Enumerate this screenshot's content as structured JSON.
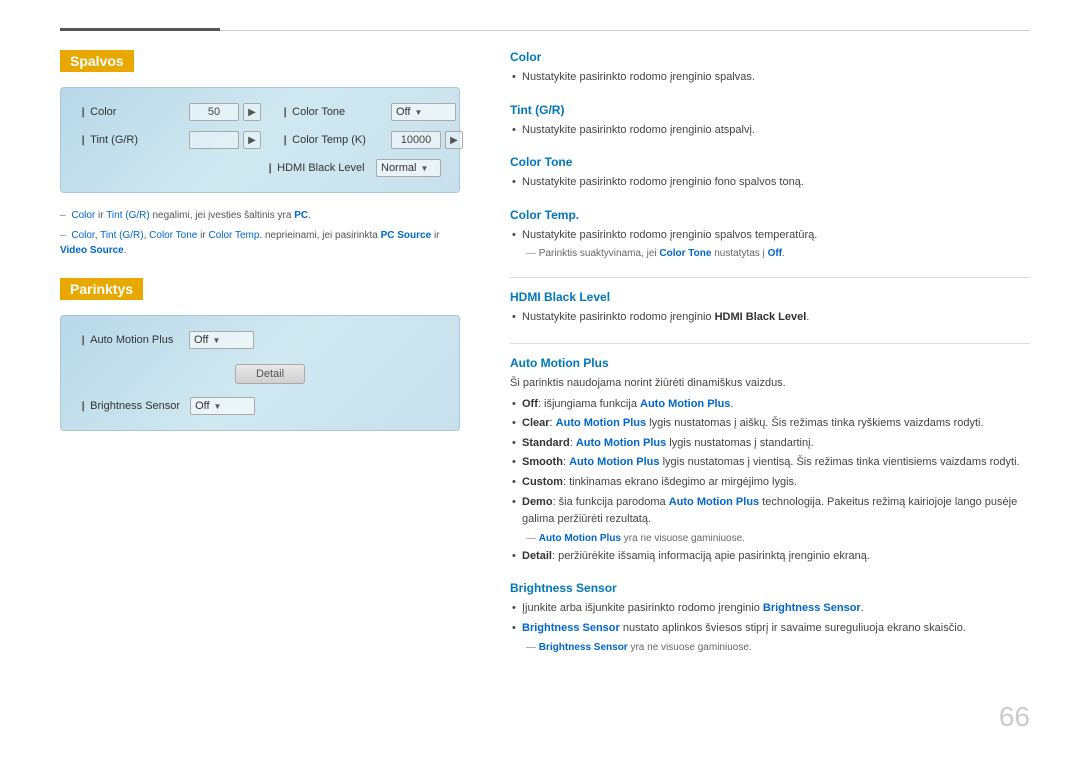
{
  "page": {
    "number": "66",
    "top_line": true
  },
  "spalvos": {
    "title": "Spalvos",
    "settings": {
      "color_label": "Color",
      "color_value": "50",
      "tint_label": "Tint (G/R)",
      "color_tone_label": "Color Tone",
      "color_tone_value": "Off",
      "color_temp_label": "Color Temp (K)",
      "color_temp_value": "10000",
      "hdmi_label": "HDMI Black Level",
      "hdmi_value": "Normal"
    },
    "notes": [
      {
        "text": "Color ir Tint (G/R) negalimi, jei įvesties šaltinis yra PC."
      },
      {
        "text": "Color, Tint (G/R), Color Tone ir Color Temp. neprieinami, jei pasirinkta PC Source ir Video Source."
      }
    ]
  },
  "parinktys": {
    "title": "Parinktys",
    "settings": {
      "auto_motion_label": "Auto Motion Plus",
      "auto_motion_value": "Off",
      "detail_btn": "Detail",
      "brightness_label": "Brightness Sensor",
      "brightness_value": "Off"
    }
  },
  "right": {
    "color_section": {
      "title": "Color",
      "text": "Nustatykite pasirinkto rodomo įrenginio spalvas."
    },
    "tint_section": {
      "title": "Tint (G/R)",
      "text": "Nustatykite pasirinkto rodomo įrenginio atspalvį."
    },
    "color_tone_section": {
      "title": "Color Tone",
      "text": "Nustatykite pasirinkto rodomo įrenginio fono spalvos toną."
    },
    "color_temp_section": {
      "title": "Color Temp.",
      "text": "Nustatykite pasirinkto rodomo įrenginio spalvos temperatūrą.",
      "sub_note": "Parinktis suaktyvinama, jei Color Tone nustatytas į Off."
    },
    "hdmi_section": {
      "title": "HDMI Black Level",
      "text": "Nustatykite pasirinkto rodomo įrenginio HDMI Black Level."
    },
    "auto_motion_section": {
      "title": "Auto Motion Plus",
      "intro": "Ši parinktis naudojama norint žiūrėti dinamiškus vaizdus.",
      "bullets": [
        {
          "prefix": "Off",
          "suffix": ": išjungiama funkcija Auto Motion Plus."
        },
        {
          "prefix": "Clear",
          "suffix": ": Auto Motion Plus lygis nustatomas į aiškų. Šis režimas tinka ryškiems vaizdams rodyti."
        },
        {
          "prefix": "Standard",
          "suffix": ": Auto Motion Plus lygis nustatomas į standartinį."
        },
        {
          "prefix": "Smooth",
          "suffix": ": Auto Motion Plus lygis nustatomas į vientisą. Šis režimas tinka vientisiems vaizdams rodyti."
        },
        {
          "prefix": "Custom",
          "suffix": ": tinkinamas ekrano išdegimo ar mirgėjimo lygis."
        },
        {
          "prefix": "Demo",
          "suffix": ": šia funkcija parodoma Auto Motion Plus technologija. Pakeitus režimą kairiojoje lango pusėje galima peržiūrėti rezultatą."
        }
      ],
      "sub_note": "Auto Motion Plus yra ne visuose gaminiuose.",
      "detail_note": "Detail: peržiūrėkite išsamią informaciją apie pasirinktą įrenginio ekraną."
    },
    "brightness_section": {
      "title": "Brightness Sensor",
      "bullets": [
        {
          "text": "Įjunkite arba išjunkite pasirinkto rodomo įrenginio Brightness Sensor."
        },
        {
          "text": "Brightness Sensor nustato aplinkos šviesos stiprį ir savaime sureguliuoja ekrano skaisčio."
        }
      ],
      "sub_note": "Brightness Sensor yra ne visuose gaminiuose."
    }
  }
}
